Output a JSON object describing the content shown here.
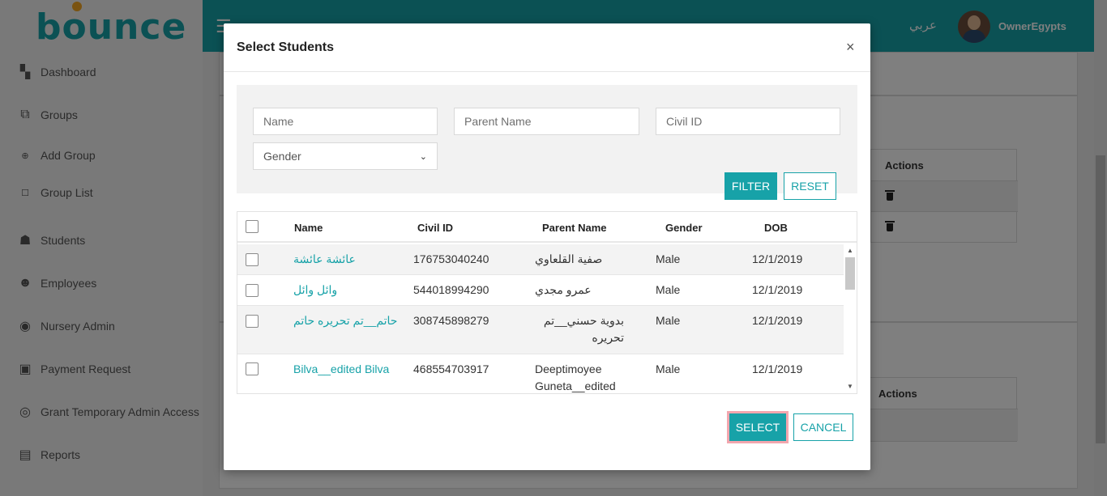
{
  "app": {
    "logo": "bounce",
    "language_toggle": "عربي",
    "user_name": "OwnerEgypts"
  },
  "sidebar": {
    "items": [
      {
        "label": "Dashboard",
        "icon": "dashboard-icon"
      },
      {
        "label": "Groups",
        "icon": "groups-icon"
      },
      {
        "label": "Add Group",
        "icon": "plus-circle-icon"
      },
      {
        "label": "Group List",
        "icon": "square-icon"
      },
      {
        "label": "Students",
        "icon": "child-icon"
      },
      {
        "label": "Employees",
        "icon": "employees-icon"
      },
      {
        "label": "Nursery Admin",
        "icon": "user-circle-icon"
      },
      {
        "label": "Payment Request",
        "icon": "payment-icon"
      },
      {
        "label": "Grant Temporary Admin Access",
        "icon": "lifebuoy-icon"
      },
      {
        "label": "Reports",
        "icon": "clipboard-icon"
      }
    ]
  },
  "background": {
    "actions_header_1": "Actions",
    "actions_header_2": "Actions"
  },
  "modal": {
    "title": "Select Students",
    "close_symbol": "×",
    "filters": {
      "name_placeholder": "Name",
      "parent_name_placeholder": "Parent Name",
      "civil_id_placeholder": "Civil ID",
      "gender_selected": "Gender",
      "filter_label": "FILTER",
      "reset_label": "RESET"
    },
    "table": {
      "columns": [
        "Name",
        "Civil ID",
        "Parent Name",
        "Gender",
        "DOB"
      ],
      "rows": [
        {
          "name": "عائشة عائشة",
          "civil_id": "176753040240",
          "parent_name": "صفية القلعاوي",
          "gender": "Male",
          "dob": "12/1/2019"
        },
        {
          "name": "وائل وائل",
          "civil_id": "544018994290",
          "parent_name": "عمرو مجدي",
          "gender": "Male",
          "dob": "12/1/2019"
        },
        {
          "name": "حاتم__تم تحريره حاتم",
          "civil_id": "308745898279",
          "parent_name": "بدوية حسني__تم تحريره",
          "gender": "Male",
          "dob": "12/1/2019"
        },
        {
          "name": "Bilva__edited Bilva",
          "civil_id": "468554703917",
          "parent_name": "Deeptimoyee Guneta__edited",
          "gender": "Male",
          "dob": "12/1/2019"
        }
      ]
    },
    "select_label": "SELECT",
    "cancel_label": "CANCEL"
  },
  "colors": {
    "accent": "#17a2a8",
    "select_focus_ring": "#f2a6ae"
  }
}
